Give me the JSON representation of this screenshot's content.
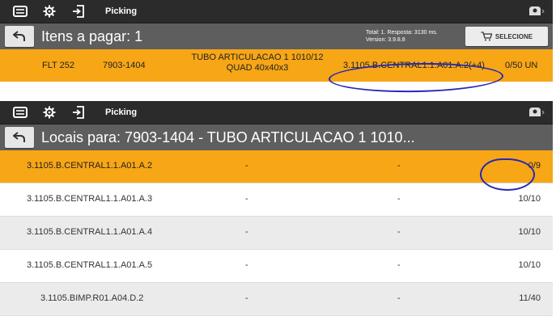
{
  "app_title": "Picking",
  "top_panel": {
    "header": {
      "title": "Itens a pagar: 1",
      "meta_line1": "Total: 1. Resposta: 3130 ms.",
      "meta_line2": "Version: 3.9.8.8",
      "select_button_label": "SELECIONE"
    },
    "item_row": {
      "code": "FLT 252",
      "sku": "7903-1404",
      "description_line1": "TUBO ARTICULACAO 1 1010/12",
      "description_line2": "QUAD 40x40x3",
      "location": "3.1105.B.CENTRAL1.1.A01.A.2(+4)",
      "quantity": "0/50 UN"
    }
  },
  "bottom_panel": {
    "header": {
      "title": "Locais para: 7903-1404 - TUBO ARTICULACAO 1 1010..."
    },
    "locations": [
      {
        "location": "3.1105.B.CENTRAL1.1.A01.A.2",
        "col2": "-",
        "col3": "-",
        "qty": "0/9"
      },
      {
        "location": "3.1105.B.CENTRAL1.1.A01.A.3",
        "col2": "-",
        "col3": "-",
        "qty": "10/10"
      },
      {
        "location": "3.1105.B.CENTRAL1.1.A01.A.4",
        "col2": "-",
        "col3": "-",
        "qty": "10/10"
      },
      {
        "location": "3.1105.B.CENTRAL1.1.A01.A.5",
        "col2": "-",
        "col3": "-",
        "qty": "10/10"
      },
      {
        "location": "3.1105.BIMP.R01.A04.D.2",
        "col2": "-",
        "col3": "-",
        "qty": "11/40"
      }
    ]
  },
  "icons": [
    "menu-icon",
    "settings-icon",
    "logout-icon",
    "profile-icon",
    "back-icon",
    "cart-icon"
  ],
  "colors": {
    "topbar": "#2b2b2b",
    "subbar": "#5e5e5e",
    "highlight": "#f7a616",
    "annotation": "#2727b8"
  }
}
